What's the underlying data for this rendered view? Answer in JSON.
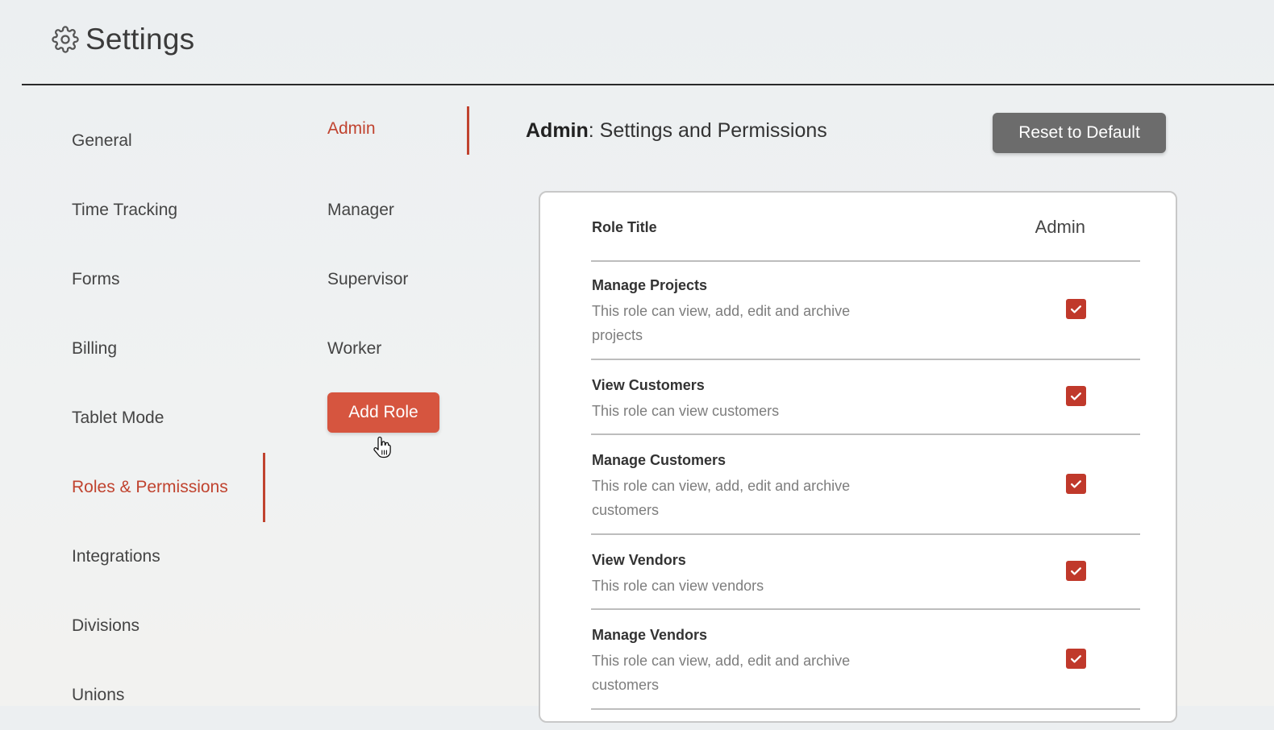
{
  "header": {
    "title": "Settings",
    "icon": "gear-icon"
  },
  "nav": {
    "items": [
      {
        "label": "General"
      },
      {
        "label": "Time Tracking"
      },
      {
        "label": "Forms"
      },
      {
        "label": "Billing"
      },
      {
        "label": "Tablet Mode"
      },
      {
        "label": "Roles & Permissions",
        "active": true
      },
      {
        "label": "Integrations"
      },
      {
        "label": "Divisions"
      },
      {
        "label": "Unions"
      }
    ]
  },
  "roles": {
    "items": [
      {
        "label": "Admin",
        "active": true
      },
      {
        "label": "Manager"
      },
      {
        "label": "Supervisor"
      },
      {
        "label": "Worker"
      }
    ],
    "add_label": "Add Role"
  },
  "panel": {
    "role_name": "Admin",
    "heading_suffix": ": Settings and Permissions",
    "reset_label": "Reset to Default",
    "table": {
      "role_title_label": "Role Title",
      "role_title_value": "Admin",
      "permissions": [
        {
          "title": "Manage Projects",
          "description": "This role can view, add, edit and archive projects",
          "checked": true
        },
        {
          "title": "View Customers",
          "description": "This role can view customers",
          "checked": true
        },
        {
          "title": "Manage Customers",
          "description": "This role can view, add, edit and archive customers",
          "checked": true
        },
        {
          "title": "View Vendors",
          "description": "This role can view vendors",
          "checked": true
        },
        {
          "title": "Manage Vendors",
          "description": "This role can view, add, edit and archive customers",
          "checked": true
        }
      ]
    }
  },
  "colors": {
    "accent": "#c0432f",
    "button_primary": "#d6553f",
    "button_secondary": "#6c6c6c",
    "checkbox": "#c0392b"
  }
}
